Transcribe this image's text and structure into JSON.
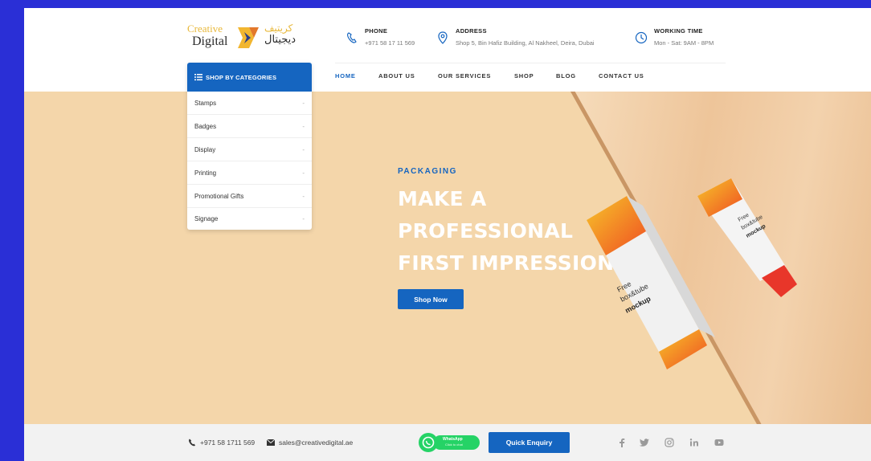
{
  "logo": {
    "en_line1": "Creative",
    "en_line2": "Digital",
    "ar_line1": "كريتيف",
    "ar_line2": "ديجيتال"
  },
  "header": {
    "phone": {
      "title": "PHONE",
      "value": "+971 58 17 11 569"
    },
    "address": {
      "title": "ADDRESS",
      "value": "Shop 5, Bin Hafiz Building, Al Nakheel, Deira, Dubai"
    },
    "working": {
      "title": "WORKING TIME",
      "value": "Mon - Sat: 9AM - 8PM"
    }
  },
  "nav": {
    "items": [
      {
        "label": "HOME",
        "active": true
      },
      {
        "label": "ABOUT US"
      },
      {
        "label": "OUR SERVICES"
      },
      {
        "label": "SHOP"
      },
      {
        "label": "BLOG"
      },
      {
        "label": "CONTACT US"
      }
    ]
  },
  "categories": {
    "title": "SHOP BY CATEGORIES",
    "items": [
      {
        "label": "Stamps"
      },
      {
        "label": "Badges"
      },
      {
        "label": "Display"
      },
      {
        "label": "Printing"
      },
      {
        "label": "Promotional Gifts"
      },
      {
        "label": "Signage"
      }
    ],
    "chevron": "-"
  },
  "hero": {
    "kicker": "PACKAGING",
    "line1": "MAKE A",
    "line2": "PROFESSIONAL",
    "line3": "FIRST IMPRESSION",
    "button": "Shop Now",
    "box_text1": "Free",
    "box_text2": "box&tube",
    "box_text3": "mockup",
    "tube_text1": "Free",
    "tube_text2": "box&tube",
    "tube_text3": "mockup"
  },
  "footer": {
    "phone": "+971 58 1711 569",
    "email": "sales@creativedigital.ae",
    "whatsapp_label": "WhatsApp",
    "whatsapp_sub": "Click to chat",
    "quick_enquiry": "Quick Enquiry"
  },
  "colors": {
    "brand_blue": "#1565c0",
    "hero_bg": "#f4d6aa",
    "frame_bg": "#2a2fd6",
    "whatsapp": "#25d366"
  }
}
